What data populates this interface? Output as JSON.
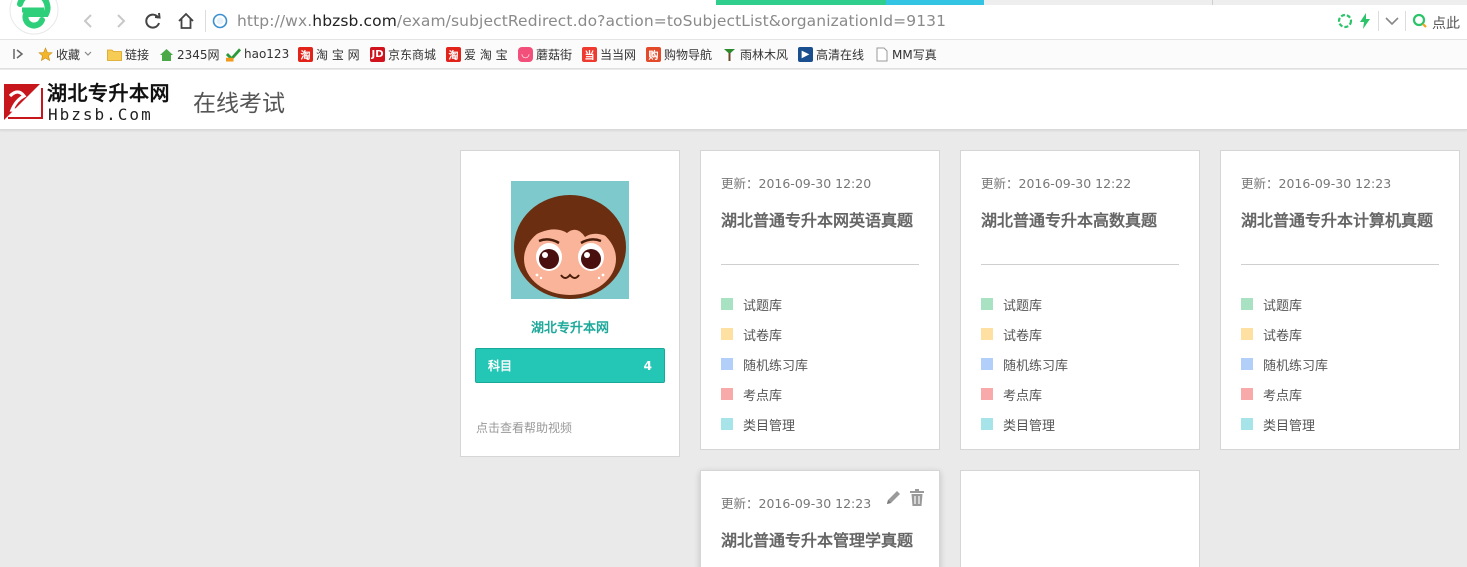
{
  "browser": {
    "url_prefix": "http://wx.",
    "url_domain": "hbzsb.com",
    "url_suffix": "/exam/subjectRedirect.do?action=toSubjectList&organizationId=9131",
    "search_hint": "点此"
  },
  "bookmarks": [
    {
      "label": "收藏",
      "icon": "star-icon",
      "color": "#f3b52b"
    },
    {
      "label": "链接",
      "icon": "folder-icon",
      "color": "#f2c248"
    },
    {
      "label": "2345网",
      "icon": "house-icon",
      "color": "#3a9b3a"
    },
    {
      "label": "hao123",
      "icon": "hao-icon",
      "color": "#2b9a3a"
    },
    {
      "label": "淘 宝 网",
      "icon": "taobao-icon",
      "color": "#e2231a"
    },
    {
      "label": "京东商城",
      "icon": "jd-icon",
      "color": "#d1131d"
    },
    {
      "label": "爱 淘 宝",
      "icon": "taobao-icon",
      "color": "#e2231a"
    },
    {
      "label": "蘑菇街",
      "icon": "mogujie-icon",
      "color": "#f2507a"
    },
    {
      "label": "当当网",
      "icon": "dangdang-icon",
      "color": "#ee3a2f"
    },
    {
      "label": "购物导航",
      "icon": "shop-icon",
      "color": "#e24a2a"
    },
    {
      "label": "雨林木风",
      "icon": "tree-icon",
      "color": "#2d8a2d"
    },
    {
      "label": "高清在线",
      "icon": "film-icon",
      "color": "#1a4f8f"
    },
    {
      "label": "MM写真",
      "icon": "page-icon",
      "color": "#999999"
    }
  ],
  "header": {
    "brand_cn": "湖北专升本网",
    "brand_en": "Hbzsb.Com",
    "page_title": "在线考试"
  },
  "profile": {
    "name": "湖北专升本网",
    "subject_label": "科目",
    "subject_count": "4",
    "help_link": "点击查看帮助视频"
  },
  "menu_labels": [
    "试题库",
    "试卷库",
    "随机练习库",
    "考点库",
    "类目管理"
  ],
  "subjects": [
    {
      "updated": "更新：2016-09-30 12:20",
      "title": "湖北普通专升本网英语真题"
    },
    {
      "updated": "更新：2016-09-30 12:22",
      "title": "湖北普通专升本高数真题"
    },
    {
      "updated": "更新：2016-09-30 12:23",
      "title": "湖北普通专升本计算机真题"
    },
    {
      "updated": "更新：2016-09-30 12:23",
      "title": "湖北普通专升本管理学真题"
    }
  ],
  "colors": {
    "accent": "#24c7b6",
    "accent_text": "#1fa99b",
    "menu_squares": [
      "#a8e2c2",
      "#fde0a2",
      "#b1cff9",
      "#f8a9a9",
      "#a6e4ea"
    ]
  }
}
